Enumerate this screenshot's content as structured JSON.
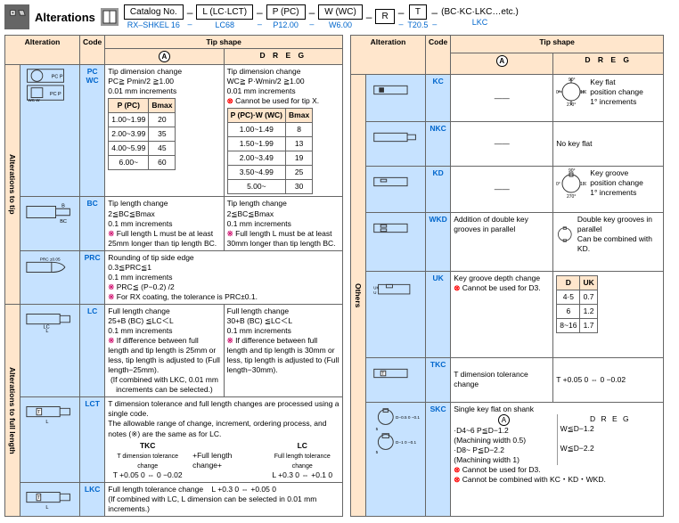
{
  "header": {
    "title": "Alterations",
    "catalog_label": "Catalog No.",
    "catalog_sub": "RX–SHKEL 16",
    "l_label": "L (LC·LCT)",
    "l_sub": "LC68",
    "p_label": "P (PC)",
    "p_sub": "P12.00",
    "w_label": "W (WC)",
    "w_sub": "W6.00",
    "r_label": "R",
    "r_sub": "",
    "t_label": "T",
    "t_sub": "T20.5",
    "etc_label": "(BC·KC·LKC…etc.)",
    "etc_sub": "LKC"
  },
  "left": {
    "col_alt": "Alteration",
    "col_code": "Code",
    "col_tip": "Tip shape",
    "col_A": "A",
    "col_DREG": "D R E G",
    "sections": {
      "tip": "Alterations to tip",
      "len": "Alterations to full length"
    },
    "rows": {
      "pcwc": {
        "code": "PC\nWC",
        "a_title": "Tip dimension change",
        "a_l1": "PC≧ Pmin/2 ≧1.00",
        "a_l2": "0.01 mm increments",
        "d_title": "Tip dimension change",
        "d_l1": "WC≧ P·Wmin/2 ≧1.00",
        "d_l2": "0.01 mm increments",
        "d_x": "Cannot be used for tip X.",
        "tbl_a_h1": "P (PC)",
        "tbl_a_h2": "Bmax",
        "tbl_a_r1c1": "1.00~1.99",
        "tbl_a_r1c2": "20",
        "tbl_a_r2c1": "2.00~3.99",
        "tbl_a_r2c2": "35",
        "tbl_a_r3c1": "4.00~5.99",
        "tbl_a_r3c2": "45",
        "tbl_a_r4c1": "6.00~",
        "tbl_a_r4c2": "60",
        "tbl_d_h1": "P (PC)·W (WC)",
        "tbl_d_h2": "Bmax",
        "tbl_d_r1c1": "1.00~1.49",
        "tbl_d_r1c2": "8",
        "tbl_d_r2c1": "1.50~1.99",
        "tbl_d_r2c2": "13",
        "tbl_d_r3c1": "2.00~3.49",
        "tbl_d_r3c2": "19",
        "tbl_d_r4c1": "3.50~4.99",
        "tbl_d_r4c2": "25",
        "tbl_d_r5c1": "5.00~",
        "tbl_d_r5c2": "30"
      },
      "bc": {
        "code": "BC",
        "a_l1": "Tip length change",
        "a_l2": "2≦BC≦Bmax",
        "a_l3": "0.1 mm increments",
        "a_l4": "Full length L must be at least 25mm longer than tip length BC.",
        "d_l1": "Tip length change",
        "d_l2": "2≦BC≦Bmax",
        "d_l3": "0.1 mm increments",
        "d_l4": "Full length L must be at least 30mm longer than tip length BC."
      },
      "prc": {
        "code": "PRC",
        "l1": "Rounding of tip side edge",
        "l2": "0.3≦PRC≦1",
        "l3": "0.1 mm increments",
        "l4": "PRC≦ (P−0.2) /2",
        "l5": "For RX coating, the tolerance is PRC±0.1.",
        "label": "PRC ±0.05"
      },
      "lc": {
        "code": "LC",
        "a_l1": "Full length change",
        "a_l2": "25+B (BC) ≦LC＜L",
        "a_l3": "0.1 mm increments",
        "a_l4": "If difference between full length and tip length is 25mm or less, tip length is adjusted to (Full length−25mm).",
        "d_l1": "Full length change",
        "d_l2": "30+B (BC) ≦LC＜L",
        "d_l3": "0.1 mm increments",
        "d_l4": "If difference between full length and tip length is 30mm or less, tip length is adjusted to (Full length−30mm).",
        "foot": "(If combined with LKC, 0.01 mm increments can be selected.)"
      },
      "lct": {
        "code": "LCT",
        "l1": "T dimension tolerance and full length changes are processed using a single code.",
        "l2": "The allowable range of change, increment, ordering process, and notes (※) are the same as for LC.",
        "l3a": "TKC",
        "l3b": "T dimension tolerance change",
        "l3c": "T +0.05 0 ⇔ 0 −0.02",
        "l3d": "+Full length change+",
        "l3e": "LC",
        "l3f": "Full length tolerance change",
        "l3g": "L +0.3 0 ⇔ +0.1 0"
      },
      "lkc": {
        "code": "LKC",
        "l1": "Full length tolerance change",
        "l2": "L +0.3 0 ⇔ +0.05 0",
        "foot": "(If combined with LC, L dimension can be selected in 0.01 mm increments.)"
      }
    }
  },
  "right": {
    "col_alt": "Alteration",
    "col_code": "Code",
    "col_tip": "Tip shape",
    "col_A": "A",
    "col_DREG": "D R E G",
    "section": "Others",
    "rows": {
      "kc": {
        "code": "KC",
        "a": "——",
        "d_l1": "Key flat",
        "d_l2": "position change",
        "d_l3": "1° increments",
        "ang0": "0°",
        "ang90": "90°",
        "ang180": "180°",
        "ang270": "270°"
      },
      "nkc": {
        "code": "NKC",
        "a": "——",
        "d": "No key flat"
      },
      "kd": {
        "code": "KD",
        "a": "——",
        "d_l1": "Key groove",
        "d_l2": "position change",
        "d_l3": "1° increments",
        "ang0": "0°",
        "ang90": "90°",
        "ang180": "180°",
        "ang270": "270°"
      },
      "wkd": {
        "code": "WKD",
        "a": "Addition of double key grooves in parallel",
        "d": "Double key grooves in parallel",
        "d2": "Can be combined with KD."
      },
      "uk": {
        "code": "UK",
        "a_l1": "Key groove depth change",
        "a_l2": "Cannot be used for D3.",
        "th1": "D",
        "th2": "UK",
        "r1c1": "4·5",
        "r1c2": "0.7",
        "r2c1": "6",
        "r2c2": "1.2",
        "r3c1": "8~16",
        "r3c2": "1.7"
      },
      "tkc": {
        "code": "TKC",
        "a": "T dimension tolerance change",
        "d": "T +0.05 0 ⇔ 0 −0.02"
      },
      "skc": {
        "code": "SKC",
        "h": "Single key flat on shank",
        "a_hdr": "A",
        "d_hdr": "D R E G",
        "a_l1": "·D4~6  P≦D−1.2",
        "a_l2": " (Machining width 0.5)",
        "a_l3": "·D8~  P≦D−2.2",
        "a_l4": " (Machining width 1)",
        "d_l1": "W≦D−1.2",
        "d_l2": "W≦D−2.2",
        "x1": "Cannot be used for D3.",
        "x2": "Cannot be combined with KC・KD・WKD.",
        "dim1": "D−0.5 0 −0.1",
        "dim2": "D−1 0 −0.1"
      }
    }
  }
}
